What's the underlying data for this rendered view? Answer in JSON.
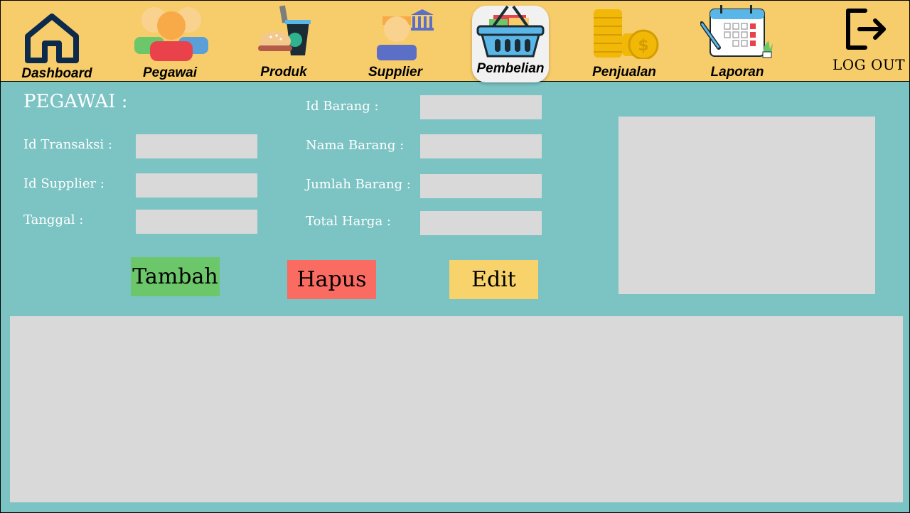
{
  "nav": {
    "dashboard": "Dashboard",
    "pegawai": "Pegawai",
    "produk": "Produk",
    "supplier": "Supplier",
    "pembelian": "Pembelian",
    "penjualan": "Penjualan",
    "laporan": "Laporan",
    "logout": "LOG OUT",
    "active": "Pembelian"
  },
  "form": {
    "section_title": "PEGAWAI :",
    "id_transaksi_label": "Id Transaksi :",
    "id_supplier_label": "Id Supplier :",
    "tanggal_label": "Tanggal :",
    "id_barang_label": "Id Barang :",
    "nama_barang_label": "Nama Barang :",
    "jumlah_barang_label": "Jumlah Barang :",
    "total_harga_label": "Total Harga :",
    "id_transaksi_value": "",
    "id_supplier_value": "",
    "tanggal_value": "",
    "id_barang_value": "",
    "nama_barang_value": "",
    "jumlah_barang_value": "",
    "total_harga_value": ""
  },
  "buttons": {
    "tambah": "Tambah",
    "hapus": "Hapus",
    "edit": "Edit"
  },
  "colors": {
    "topbar": "#f7cd6b",
    "background": "#7cc3c4",
    "field": "#d9d9d9",
    "tambah": "#6cc66a",
    "hapus": "#fa6b62",
    "edit": "#f8d26a"
  }
}
